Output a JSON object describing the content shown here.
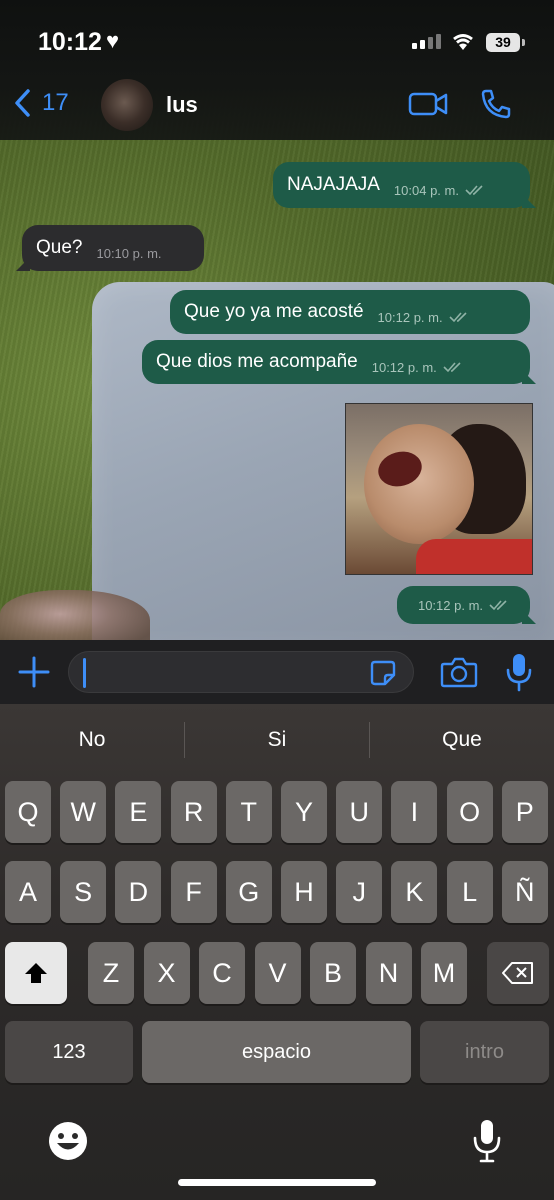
{
  "status": {
    "time": "10:12",
    "battery": "39"
  },
  "header": {
    "back_count": "17",
    "contact_name": "lus"
  },
  "messages": [
    {
      "text": "NAJAJAJA",
      "time": "10:04 p. m."
    },
    {
      "text": "Que?",
      "time": "10:10 p. m."
    },
    {
      "text": "Que yo ya me acosté",
      "time": "10:12 p. m."
    },
    {
      "text": "Que dios me acompañe",
      "time": "10:12 p. m."
    },
    {
      "text": "",
      "time": "10:12 p. m."
    }
  ],
  "input": {
    "value": ""
  },
  "keyboard": {
    "suggestions": [
      "No",
      "Si",
      "Que"
    ],
    "row1": [
      "Q",
      "W",
      "E",
      "R",
      "T",
      "Y",
      "U",
      "I",
      "O",
      "P"
    ],
    "row2": [
      "A",
      "S",
      "D",
      "F",
      "G",
      "H",
      "J",
      "K",
      "L",
      "Ñ"
    ],
    "row3": [
      "Z",
      "X",
      "C",
      "V",
      "B",
      "N",
      "M"
    ],
    "numbers": "123",
    "space": "espacio",
    "return": "intro"
  }
}
